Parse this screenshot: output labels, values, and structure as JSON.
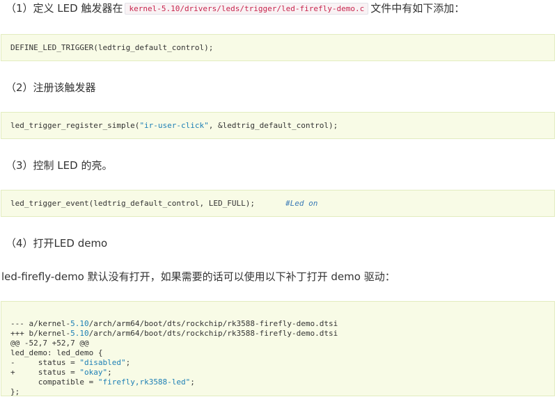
{
  "step1": {
    "prefix": "（1）定义 LED 触发器在",
    "path": "kernel-5.10/drivers/leds/trigger/led-firefly-demo.c",
    "suffix": "文件中有如下添加："
  },
  "code1": "DEFINE_LED_TRIGGER(ledtrig_default_control);",
  "step2": "（2）注册该触发器",
  "code2": {
    "pre": "led_trigger_register_simple(",
    "str": "\"ir-user-click\"",
    "post": ", &ledtrig_default_control);"
  },
  "step3": "（3）控制 LED 的亮。",
  "code3": {
    "code": "led_trigger_event(ledtrig_default_control, LED_FULL);",
    "comment": "#Led on"
  },
  "step4": "（4）打开LED demo",
  "intro": "led-firefly-demo 默认没有打开，如果需要的话可以使用以下补丁打开 demo 驱动：",
  "patch": {
    "l1_pre": "--- a/kernel-",
    "l1_ver": "5.10",
    "l1_post": "/arch/arm64/boot/dts/rockchip/rk3588-firefly-demo.dtsi",
    "l2_pre": "+++ b/kernel-",
    "l2_ver": "5.10",
    "l2_post": "/arch/arm64/boot/dts/rockchip/rk3588-firefly-demo.dtsi",
    "l3": "@@ -52,7 +52,7 @@",
    "l4": "led_demo: led_demo {",
    "l5_pre": "-     status = ",
    "l5_str": "\"disabled\"",
    "l5_post": ";",
    "l6_pre": "+     status = ",
    "l6_str": "\"okay\"",
    "l6_post": ";",
    "l7_pre": "      compatible = ",
    "l7_str": "\"firefly,rk3588-led\"",
    "l7_post": ";",
    "l8": "};"
  }
}
